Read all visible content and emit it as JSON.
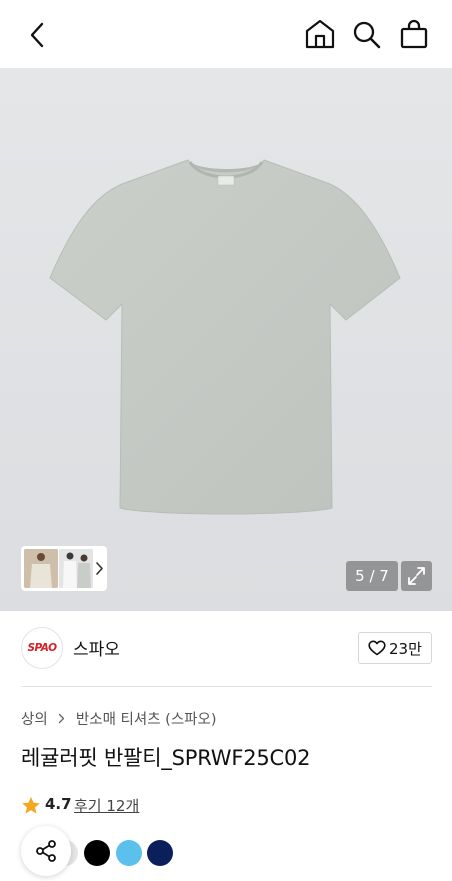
{
  "header": {
    "back_icon": "chevron-left-icon",
    "home_icon": "home-icon",
    "search_icon": "search-icon",
    "cart_icon": "shopping-bag-icon"
  },
  "gallery": {
    "counter": "5 / 7",
    "expand_icon": "expand-icon",
    "thumbnail_next_icon": "chevron-right-icon",
    "background": "#e7e8ea",
    "product_color": "#c6cac5",
    "tag_text": "SPAO"
  },
  "brand": {
    "logo_text": "SPAO",
    "logo_color": "#d2232a",
    "name": "스파오",
    "likes": "23만"
  },
  "breadcrumb": {
    "category": "상의",
    "subcategory": "반소매 티셔츠 (스파오)"
  },
  "product": {
    "title": "레귤러핏 반팔티_SPRWF25C02",
    "rating": "4.7",
    "reviews": "후기 12개",
    "star_color": "#f5a623"
  },
  "colors": {
    "swatches": [
      "#e6e6e6",
      "#000000",
      "#5bc0eb",
      "#0a1f5c"
    ]
  }
}
